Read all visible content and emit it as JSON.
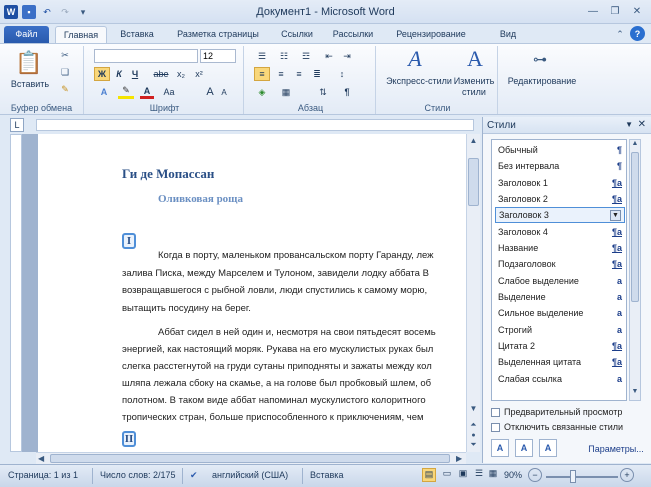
{
  "window": {
    "title": "Документ1 - Microsoft Word"
  },
  "tabs": [
    "Файл",
    "Главная",
    "Вставка",
    "Разметка страницы",
    "Ссылки",
    "Рассылки",
    "Рецензирование",
    "Вид"
  ],
  "ribbon": {
    "font_name": "",
    "font_size": "12",
    "paste_label": "Вставить",
    "clipboard_label": "Буфер обмена",
    "font_label": "Шрифт",
    "paragraph_label": "Абзац",
    "styles_label": "Стили",
    "express_styles": "Экспресс-стили",
    "change_styles": "Изменить стили",
    "editing": "Редактирование",
    "bold": "Ж",
    "italic": "К",
    "underline": "Ч",
    "strike": "abe",
    "subscript": "x₂",
    "superscript": "x²",
    "font_grow": "A",
    "font_shrink": "A",
    "case": "Aa",
    "pilcrow": "¶"
  },
  "document": {
    "author": "Ги де Мопассан",
    "title": "Оливковая роща",
    "section1": "I",
    "section2": "II",
    "paragraphs": [
      "Когда в порту, маленьком провансальском порту Гаранду, леж",
      "залива Писка, между Марселем и Тулоном, завидели лодку аббата В",
      "возвращавшегося с рыбной ловли, люди спустились к самому морю,",
      "вытащить посудину на берег.",
      "Аббат сидел в ней один и, несмотря на свои пятьдесят восемь",
      "энергией, как настоящий моряк. Рукава на его мускулистых руках был",
      "слегка расстегнутой на груди сутаны приподняты и зажаты между кол",
      "шляпа лежала сбоку на скамье, а на голове был пробковый шлем, об",
      "полотном. В таком виде аббат напоминал мускулистого колоритного",
      "тропических стран, больше приспособленного к приключениям, чем"
    ]
  },
  "styles_pane": {
    "title": "Стили",
    "items": [
      {
        "name": "Обычный",
        "mark": "¶"
      },
      {
        "name": "Без интервала",
        "mark": "¶"
      },
      {
        "name": "Заголовок 1",
        "mark": "¶a"
      },
      {
        "name": "Заголовок 2",
        "mark": "¶a"
      },
      {
        "name": "Заголовок 3",
        "mark": ""
      },
      {
        "name": "Заголовок 4",
        "mark": "¶a"
      },
      {
        "name": "Название",
        "mark": "¶a"
      },
      {
        "name": "Подзаголовок",
        "mark": "¶a"
      },
      {
        "name": "Слабое выделение",
        "mark": "a"
      },
      {
        "name": "Выделение",
        "mark": "a"
      },
      {
        "name": "Сильное выделение",
        "mark": "a"
      },
      {
        "name": "Строгий",
        "mark": "a"
      },
      {
        "name": "Цитата 2",
        "mark": "¶a"
      },
      {
        "name": "Выделенная цитата",
        "mark": "¶a"
      },
      {
        "name": "Слабая ссылка",
        "mark": "a"
      }
    ],
    "preview": "Предварительный просмотр",
    "disable_linked": "Отключить связанные стили",
    "params": "Параметры..."
  },
  "status": {
    "page": "Страница: 1 из 1",
    "words": "Число слов: 2/175",
    "language": "английский (США)",
    "mode": "Вставка",
    "zoom": "90%"
  },
  "colors": {
    "accent": "#2a5aad",
    "heading": "#2a4f86",
    "subheading": "#6a8fc2"
  }
}
